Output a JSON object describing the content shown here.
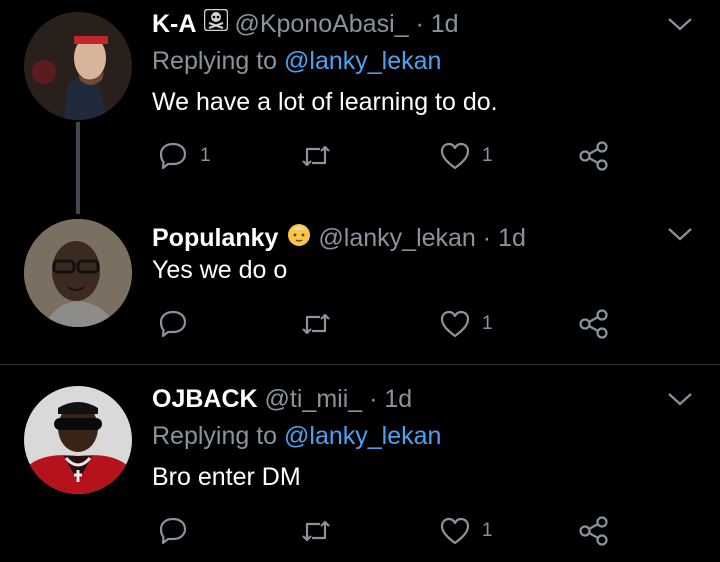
{
  "tweets": [
    {
      "name": "K-A",
      "name_icon": "skull-crossbones-icon",
      "handle": "@KponoAbasi_",
      "dot": "·",
      "time": "1d",
      "replying_prefix": "Replying to ",
      "replying_handle": "@lanky_lekan",
      "text": "We have a lot of learning to do.",
      "reply_count": "1",
      "retweet_count": "",
      "like_count": "1"
    },
    {
      "name": "Populanky",
      "name_icon": "baby-face-emoji-icon",
      "handle": "@lanky_lekan",
      "dot": "·",
      "time": "1d",
      "text": "Yes we do o",
      "reply_count": "",
      "retweet_count": "",
      "like_count": "1"
    },
    {
      "name": "OJBACK",
      "handle": "@ti_mii_",
      "dot": "·",
      "time": "1d",
      "replying_prefix": "Replying to ",
      "replying_handle": "@lanky_lekan",
      "text": "Bro enter DM",
      "reply_count": "",
      "retweet_count": "",
      "like_count": "1"
    }
  ],
  "colors": {
    "background": "#000000",
    "text": "#ffffff",
    "secondary": "#8a939d",
    "link": "#4aa3f0",
    "thread_line": "#42474d"
  },
  "icons": [
    "reply-icon",
    "retweet-icon",
    "like-icon",
    "share-icon",
    "chevron-down-icon"
  ]
}
